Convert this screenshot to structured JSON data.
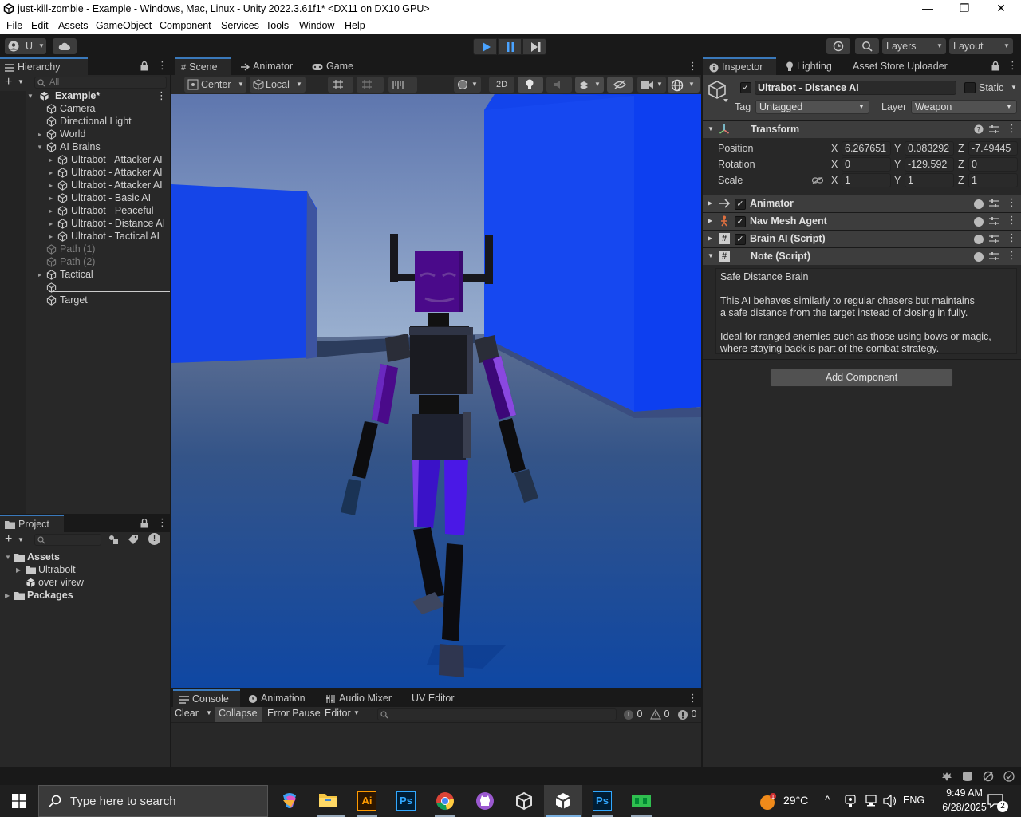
{
  "window": {
    "title": "just-kill-zombie - Example - Windows, Mac, Linux - Unity 2022.3.61f1* <DX11 on DX10 GPU>",
    "minimize": "—",
    "maximize": "❐",
    "close": "✕"
  },
  "menu": [
    "File",
    "Edit",
    "Assets",
    "GameObject",
    "Component",
    "Services",
    "Tools",
    "Window",
    "Help"
  ],
  "toolbar": {
    "account": "U",
    "layers": "Layers",
    "layout": "Layout"
  },
  "hierarchy": {
    "tab": "Hierarchy",
    "search_placeholder": "All",
    "scene": "Example*",
    "items": [
      {
        "label": "Camera",
        "indent": 1,
        "fold": false,
        "dim": false
      },
      {
        "label": "Directional Light",
        "indent": 1,
        "fold": false,
        "dim": false
      },
      {
        "label": "World",
        "indent": 1,
        "fold": true,
        "dim": false
      },
      {
        "label": "AI Brains",
        "indent": 1,
        "fold": true,
        "open": true,
        "dim": false
      },
      {
        "label": "Ultrabot - Attacker AI",
        "indent": 2,
        "fold": true,
        "dim": false
      },
      {
        "label": "Ultrabot - Attacker AI",
        "indent": 2,
        "fold": true,
        "dim": false
      },
      {
        "label": "Ultrabot - Attacker AI",
        "indent": 2,
        "fold": true,
        "dim": false
      },
      {
        "label": "Ultrabot - Basic AI",
        "indent": 2,
        "fold": true,
        "dim": false
      },
      {
        "label": "Ultrabot - Peaceful",
        "indent": 2,
        "fold": true,
        "dim": false
      },
      {
        "label": "Ultrabot - Distance AI",
        "indent": 2,
        "fold": true,
        "dim": false
      },
      {
        "label": "Ultrabot - Tactical AI",
        "indent": 2,
        "fold": true,
        "dim": false
      },
      {
        "label": "Path (1)",
        "indent": 1,
        "fold": false,
        "dim": true
      },
      {
        "label": "Path (2)",
        "indent": 1,
        "fold": false,
        "dim": true
      },
      {
        "label": "Tactical",
        "indent": 1,
        "fold": true,
        "dim": false
      },
      {
        "label": "",
        "indent": 1,
        "fold": false,
        "dim": false
      },
      {
        "label": "Target",
        "indent": 1,
        "fold": false,
        "dim": false
      }
    ]
  },
  "project": {
    "tab": "Project",
    "items": [
      {
        "label": "Assets",
        "bold": true
      },
      {
        "label": "Ultrabolt",
        "bold": false
      },
      {
        "label": "over virew",
        "bold": false
      },
      {
        "label": "Packages",
        "bold": true
      }
    ]
  },
  "scene_view": {
    "tabs": [
      "Scene",
      "Animator",
      "Game"
    ],
    "pivot": "Center",
    "space": "Local",
    "mode2d": "2D"
  },
  "console": {
    "tabs": [
      "Console",
      "Animation",
      "Audio Mixer",
      "UV Editor"
    ],
    "clear": "Clear",
    "collapse": "Collapse",
    "error_pause": "Error Pause",
    "editor": "Editor",
    "logs": "0",
    "warnings": "0",
    "errors": "0"
  },
  "inspector": {
    "tabs": [
      "Inspector",
      "Lighting",
      "Asset Store Uploader"
    ],
    "object_name": "Ultrabot - Distance AI",
    "static_label": "Static",
    "tag_label": "Tag",
    "tag_value": "Untagged",
    "layer_label": "Layer",
    "layer_value": "Weapon",
    "transform": {
      "title": "Transform",
      "position_label": "Position",
      "rotation_label": "Rotation",
      "scale_label": "Scale",
      "position": {
        "x": "6.267651",
        "y": "0.083292",
        "z": "-7.49445"
      },
      "rotation": {
        "x": "0",
        "y": "-129.592",
        "z": "0"
      },
      "scale": {
        "x": "1",
        "y": "1",
        "z": "1"
      }
    },
    "components": [
      "Animator",
      "Nav Mesh Agent",
      "Brain AI (Script)"
    ],
    "note": {
      "title": "Note (Script)",
      "heading": "Safe Distance Brain",
      "p1a": "This AI behaves similarly to regular chasers but maintains",
      "p1b": "a safe distance from the target instead of closing in fully.",
      "p2a": "Ideal for ranged enemies such as those using bows or magic,",
      "p2b": "where staying back is part of the combat strategy."
    },
    "add_component": "Add Component"
  },
  "taskbar": {
    "search_placeholder": "Type here to search",
    "temperature": "29°C",
    "language": "ENG",
    "time": "9:49 AM",
    "date": "6/28/2025",
    "notifications": "2"
  },
  "colors": {
    "accent": "#3a79bb",
    "panel": "#282828",
    "sky_top": "#5f77b0",
    "wall_blue": "#1144ee",
    "robot_purple": "#4a0a8a"
  }
}
